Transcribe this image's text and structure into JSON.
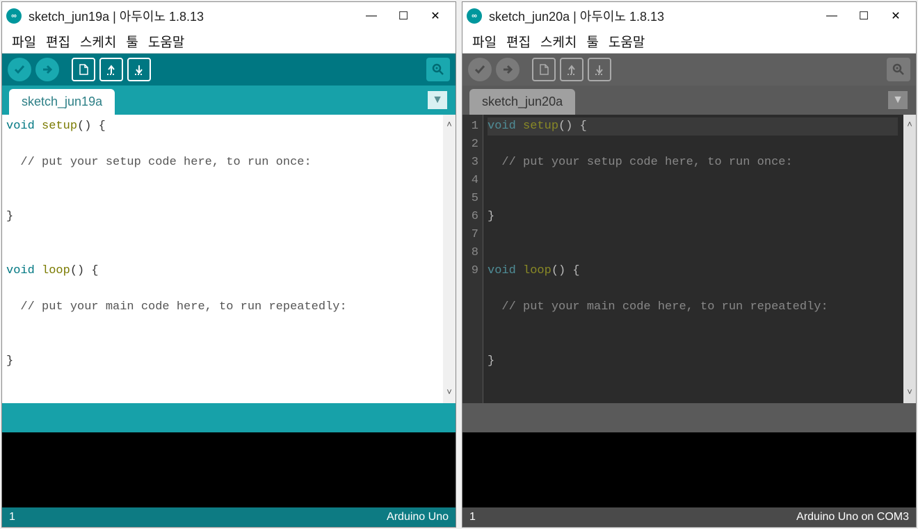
{
  "windows": [
    {
      "id": "light",
      "title": "sketch_jun19a | 아두이노 1.8.13",
      "tab": "sketch_jun19a",
      "show_gutter": false,
      "lines": [
        {
          "t": "setup_sig",
          "text_kw": "void",
          "text_fn": "setup",
          "text_tail": "() {"
        },
        {
          "t": "comment",
          "text": "  // put your setup code here, to run once:"
        },
        {
          "t": "blank",
          "text": ""
        },
        {
          "t": "plain",
          "text": "}"
        },
        {
          "t": "blank",
          "text": ""
        },
        {
          "t": "loop_sig",
          "text_kw": "void",
          "text_fn": "loop",
          "text_tail": "() {"
        },
        {
          "t": "comment",
          "text": "  // put your main code here, to run repeatedly:"
        },
        {
          "t": "blank",
          "text": ""
        },
        {
          "t": "plain",
          "text": "}"
        }
      ],
      "status_left": "1",
      "status_right": "Arduino Uno"
    },
    {
      "id": "dark",
      "title": "sketch_jun20a | 아두이노 1.8.13",
      "tab": "sketch_jun20a",
      "show_gutter": true,
      "lines": [
        {
          "n": 1,
          "t": "setup_sig",
          "hl": true,
          "text_kw": "void",
          "text_fn": "setup",
          "text_tail": "() {"
        },
        {
          "n": 2,
          "t": "comment",
          "text": "  // put your setup code here, to run once:"
        },
        {
          "n": 3,
          "t": "blank",
          "text": ""
        },
        {
          "n": 4,
          "t": "plain",
          "text": "}"
        },
        {
          "n": 5,
          "t": "blank",
          "text": ""
        },
        {
          "n": 6,
          "t": "loop_sig",
          "text_kw": "void",
          "text_fn": "loop",
          "text_tail": "() {"
        },
        {
          "n": 7,
          "t": "comment",
          "text": "  // put your main code here, to run repeatedly:"
        },
        {
          "n": 8,
          "t": "blank",
          "text": ""
        },
        {
          "n": 9,
          "t": "plain",
          "text": "}"
        }
      ],
      "status_left": "1",
      "status_right": "Arduino Uno on COM3"
    }
  ],
  "menu": [
    "파일",
    "편집",
    "스케치",
    "툴",
    "도움말"
  ],
  "logo_glyph": "∞"
}
